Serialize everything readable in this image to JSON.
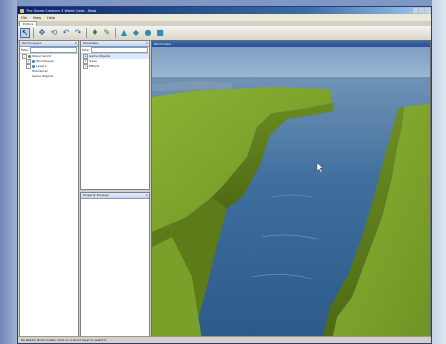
{
  "window": {
    "title": "The Game Creators 3 World Code - Beta"
  },
  "menu": [
    "File",
    "View",
    "Help"
  ],
  "tabs": [
    {
      "label": "Editors",
      "active": true
    },
    {
      "label": "",
      "active": false
    },
    {
      "label": "",
      "active": false
    },
    {
      "label": "Terrain",
      "active": false
    }
  ],
  "toolbar": {
    "select_icon": "arrow-cursor-icon",
    "move_icon": "move-arrows-icon",
    "rotate_icon": "rotate-icon",
    "undo_icon": "undo-icon",
    "redo_icon": "redo-icon",
    "paint_icon": "paint-bucket-icon",
    "brush_icon": "brush-icon",
    "terrain_icons": [
      "terrain-raise-icon",
      "terrain-lower-icon",
      "terrain-smooth-icon",
      "terrain-flatten-icon"
    ]
  },
  "world_layers": {
    "title": "World Layers",
    "filter_label": "Filter",
    "items": [
      {
        "label": "Object world",
        "level": 0,
        "icon": "globe"
      },
      {
        "label": "World/Layer",
        "level": 1,
        "icon": "dot"
      },
      {
        "label": "Level 1",
        "level": 1,
        "icon": "dot"
      },
      {
        "label": "Helmsman",
        "level": 2,
        "icon": "none"
      },
      {
        "label": "Game Objects",
        "level": 2,
        "icon": "none"
      }
    ]
  },
  "templates": {
    "title": "Templates",
    "filter_label": "Filter",
    "items": [
      {
        "label": "Game Objects",
        "selected": true
      },
      {
        "label": "Trees",
        "selected": false
      },
      {
        "label": "Effects",
        "selected": false
      }
    ]
  },
  "property_browser": {
    "title": "Property Browser"
  },
  "viewport": {
    "title": "World View"
  },
  "status": {
    "text": "Re Ready! Build routes: Click on a world layer to select it"
  },
  "colors": {
    "title_start": "#0a246a",
    "water": "#3b6b9a",
    "grass": "#7ba12a",
    "sky": "#8fb0cf"
  }
}
